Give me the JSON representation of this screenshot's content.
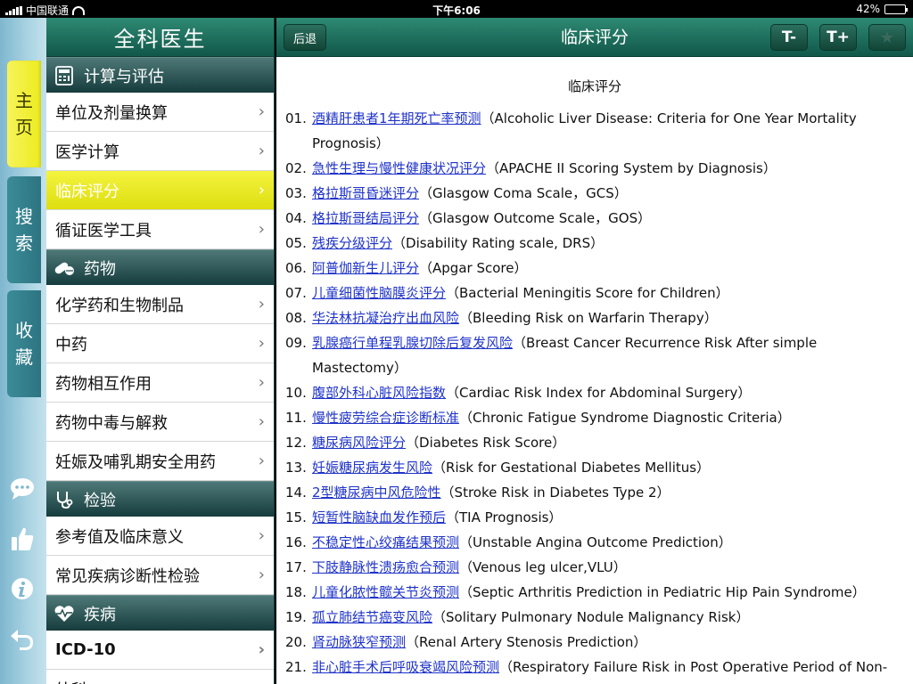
{
  "status_bar": {
    "carrier": "中国联通",
    "time": "下午6:06",
    "battery": "42%"
  },
  "dock": {
    "tabs": [
      {
        "label": "主页",
        "chars": [
          "主",
          "页"
        ],
        "active": true
      },
      {
        "label": "搜索",
        "chars": [
          "搜",
          "索"
        ],
        "active": false
      },
      {
        "label": "收藏",
        "chars": [
          "收",
          "藏"
        ],
        "active": false
      }
    ],
    "icons": [
      "chat-bubble-icon",
      "thumbs-up-icon",
      "info-icon",
      "back-arrow-icon"
    ]
  },
  "sidebar": {
    "title": "全科医生",
    "sections": [
      {
        "label": "计算与评估",
        "icon": "calculator-icon",
        "items": [
          "单位及剂量换算",
          "医学计算",
          "临床评分",
          "循证医学工具"
        ]
      },
      {
        "label": "药物",
        "icon": "pill-icon",
        "items": [
          "化学药和生物制品",
          "中药",
          "药物相互作用",
          "药物中毒与解救",
          "妊娠及哺乳期安全用药"
        ]
      },
      {
        "label": "检验",
        "icon": "stethoscope-icon",
        "items": [
          "参考值及临床意义",
          "常见疾病诊断性检验"
        ]
      },
      {
        "label": "疾病",
        "icon": "heartbeat-icon",
        "items": [
          "ICD-10",
          "外科"
        ]
      }
    ],
    "selected_item": "临床评分"
  },
  "navbar": {
    "back_label": "后退",
    "title": "临床评分",
    "font_decrease_label": "T-",
    "font_increase_label": "T+",
    "favorite_icon": "star-icon"
  },
  "content": {
    "heading": "临床评分",
    "entries": [
      {
        "num": "01.",
        "link": "酒精肝患者1年期死亡率预测",
        "desc": "（Alcoholic Liver Disease: Criteria for One Year Mortality Prognosis）"
      },
      {
        "num": "02.",
        "link": "急性生理与慢性健康状况评分",
        "desc": "（APACHE II Scoring System by Diagnosis）"
      },
      {
        "num": "03.",
        "link": "格拉斯哥昏迷评分",
        "desc": "（Glasgow Coma Scale，GCS）"
      },
      {
        "num": "04.",
        "link": "格拉斯哥结局评分",
        "desc": "（Glasgow Outcome Scale，GOS）"
      },
      {
        "num": "05.",
        "link": "残疾分级评分",
        "desc": "（Disability Rating scale, DRS）"
      },
      {
        "num": "06.",
        "link": "阿普伽新生儿评分",
        "desc": "（Apgar Score）"
      },
      {
        "num": "07.",
        "link": "儿童细菌性脑膜炎评分",
        "desc": "（Bacterial Meningitis Score for Children）"
      },
      {
        "num": "08.",
        "link": "华法林抗凝治疗出血风险",
        "desc": "（Bleeding Risk on Warfarin Therapy）"
      },
      {
        "num": "09.",
        "link": "乳腺癌行单程乳腺切除后复发风险",
        "desc": "（Breast Cancer Recurrence Risk After simple Mastectomy）"
      },
      {
        "num": "10.",
        "link": "腹部外科心脏风险指数",
        "desc": "（Cardiac Risk Index for Abdominal Surgery）"
      },
      {
        "num": "11.",
        "link": "慢性疲劳综合症诊断标准",
        "desc": "（Chronic Fatigue Syndrome Diagnostic Criteria）"
      },
      {
        "num": "12.",
        "link": "糖尿病风险评分",
        "desc": "（Diabetes Risk Score）"
      },
      {
        "num": "13.",
        "link": "妊娠糖尿病发生风险",
        "desc": "（Risk for Gestational Diabetes Mellitus）"
      },
      {
        "num": "14.",
        "link": "2型糖尿病中风危险性",
        "desc": "（Stroke Risk in Diabetes Type 2）"
      },
      {
        "num": "15.",
        "link": "短暂性脑缺血发作预后",
        "desc": "（TIA Prognosis）"
      },
      {
        "num": "16.",
        "link": "不稳定性心绞痛结果预测",
        "desc": "（Unstable Angina Outcome Prediction）"
      },
      {
        "num": "17.",
        "link": "下肢静脉性溃疡愈合预测",
        "desc": "（Venous leg ulcer,VLU）"
      },
      {
        "num": "18.",
        "link": "儿童化脓性髋关节炎预测",
        "desc": "（Septic Arthritis Prediction in Pediatric Hip Pain Syndrome）"
      },
      {
        "num": "19.",
        "link": "孤立肺结节癌变风险",
        "desc": "（Solitary Pulmonary Nodule Malignancy Risk）"
      },
      {
        "num": "20.",
        "link": "肾动脉狭窄预测",
        "desc": "（Renal Artery Stenosis Prediction）"
      },
      {
        "num": "21.",
        "link": "非心脏手术后呼吸衰竭风险预测",
        "desc": "（Respiratory Failure Risk in Post Operative Period of Non-"
      }
    ]
  },
  "colors": {
    "header_green": "#1e6e5c",
    "selected_yellow": "#f0ef2a",
    "link_blue": "#1f33c8",
    "dock_blue": "#a9d3e2"
  }
}
